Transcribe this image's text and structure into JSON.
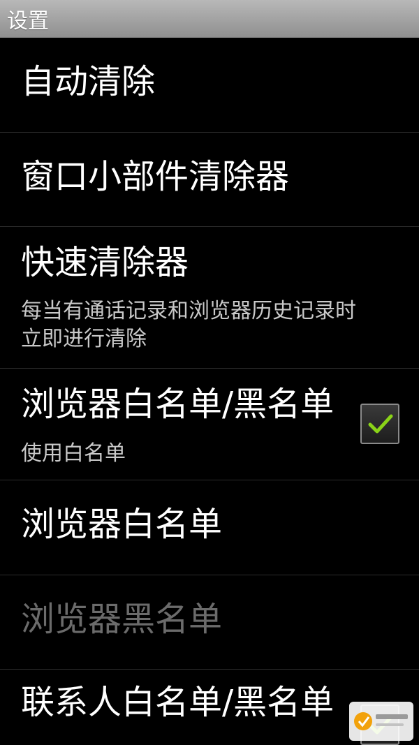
{
  "header": {
    "title": "设置"
  },
  "preferences": [
    {
      "title": "自动清除"
    },
    {
      "title": "窗口小部件清除器"
    },
    {
      "title": "快速清除器",
      "summary_line1": "每当有通话记录和浏览器历史记录时",
      "summary_line2": "立即进行清除"
    },
    {
      "title": "浏览器白名单/黑名单",
      "summary": "使用白名单",
      "checked": true
    },
    {
      "title": "浏览器白名单"
    },
    {
      "title": "浏览器黑名单",
      "enabled": false
    },
    {
      "title": "联系人白名单/黑名单",
      "checked": true
    }
  ],
  "icons": {
    "checkbox": "check-icon",
    "watermark": "kuaizai-logo"
  },
  "colors": {
    "background": "#000000",
    "check": "#8ad318",
    "disabled_text": "#6b6b6b",
    "title_bar": "#a0a0a0"
  }
}
